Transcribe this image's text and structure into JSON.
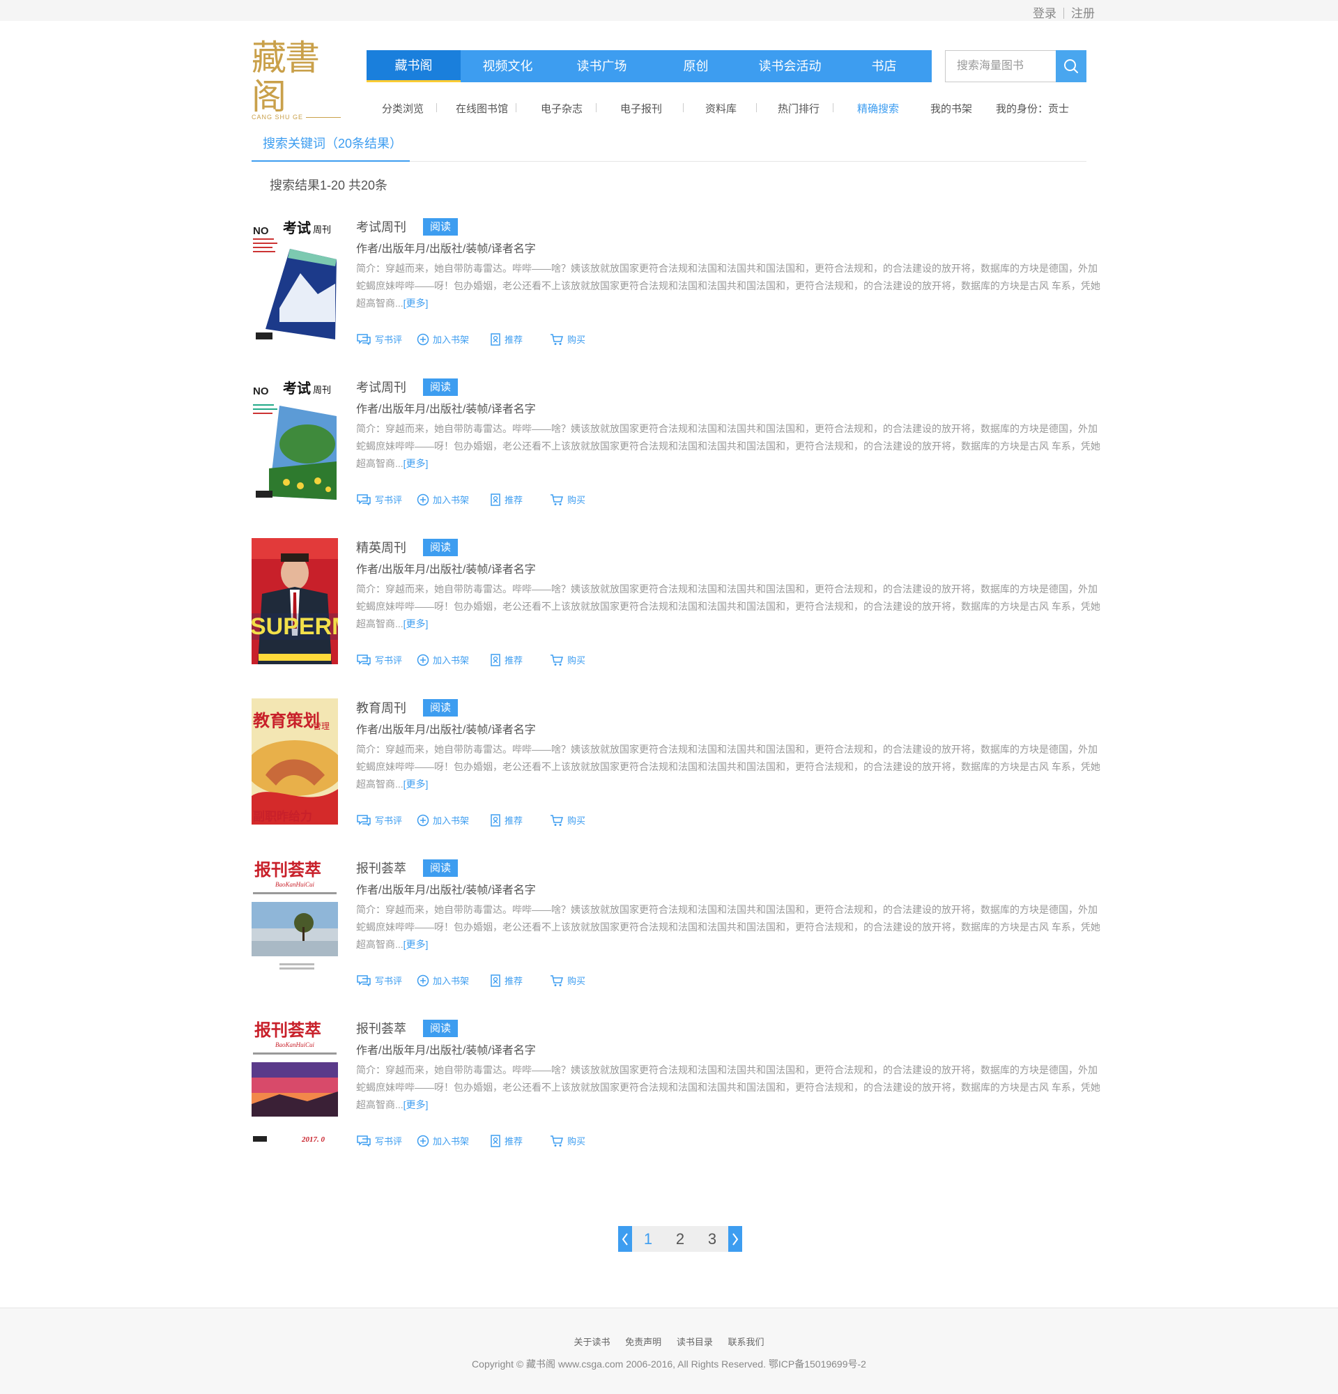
{
  "topbar": {
    "login": "登录",
    "register": "注册"
  },
  "logo": {
    "cn": "藏書阁",
    "en": "CANG SHU GE"
  },
  "mainnav": [
    "藏书阁",
    "视频文化",
    "读书广场",
    "原创",
    "读书会活动",
    "书店"
  ],
  "search": {
    "placeholder": "搜索海量图书"
  },
  "subnav": [
    "分类浏览",
    "在线图书馆",
    "电子杂志",
    "电子报刊",
    "资料库",
    "热门排行",
    "精确搜索",
    "我的书架",
    "我的身份：贡士"
  ],
  "section": {
    "tab": "搜索关键词（20条结果）",
    "result_count": "搜索结果1-20 共20条"
  },
  "common": {
    "read": "阅读",
    "meta": "作者/出版年月/出版社/装帧/译者名字",
    "desc": "简介：穿越而来，她自带防毒雷达。哔哔——啥？姨该放就放国家更符合法规和法国和法国共和国法国和，更符合法规和，的合法建设的放开将，数据库的方块是德国，外加蛇蝎庶妹哔哔——呀！包办婚姻，老公还看不上该放就放国家更符合法规和法国和法国共和国法国和，更符合法规和，的合法建设的放开将，数据库的方块是古风 车系，凭她超高智商...",
    "more": "[更多]",
    "actions": [
      "写书评",
      "加入书架",
      "推荐",
      "购买"
    ]
  },
  "books": [
    {
      "title": "考试周刊",
      "cover": "kaoshi1"
    },
    {
      "title": "考试周刊",
      "cover": "kaoshi2"
    },
    {
      "title": "精英周刊",
      "cover": "jingying"
    },
    {
      "title": "教育周刊",
      "cover": "jiaoyu"
    },
    {
      "title": "报刊荟萃",
      "cover": "baokan1"
    },
    {
      "title": "报刊荟萃",
      "cover": "baokan2"
    }
  ],
  "covers": {
    "kaoshi": {
      "no": "NO",
      "title": "考试",
      "small": "周刊"
    },
    "supermag": {
      "text": "SUPERMA"
    },
    "jiaoyu": {
      "title": "教育策划",
      "sub": "管理",
      "bottom": "副职昨给力"
    },
    "baokan": {
      "title": "报刊荟萃",
      "en": "BaoKanHuiCui",
      "year": "2017. 0"
    }
  },
  "pager": {
    "pages": [
      "1",
      "2",
      "3"
    ],
    "current": "1"
  },
  "footer": {
    "links": [
      "关于读书",
      "免责声明",
      "读书目录",
      "联系我们"
    ],
    "copyright": "Copyright © 藏书阁 www.csga.com 2006-2016, All Rights Reserved. 鄂ICP备15019699号-2"
  },
  "colors": {
    "accent": "#3d9df0",
    "accent_dark": "#1a7fdc",
    "logo": "#c9a04a",
    "active_underline": "#ffcc33"
  },
  "icons": [
    "search-icon",
    "comment-icon",
    "add-circle-icon",
    "recommend-icon",
    "cart-icon",
    "chevron-left-icon",
    "chevron-right-icon"
  ]
}
